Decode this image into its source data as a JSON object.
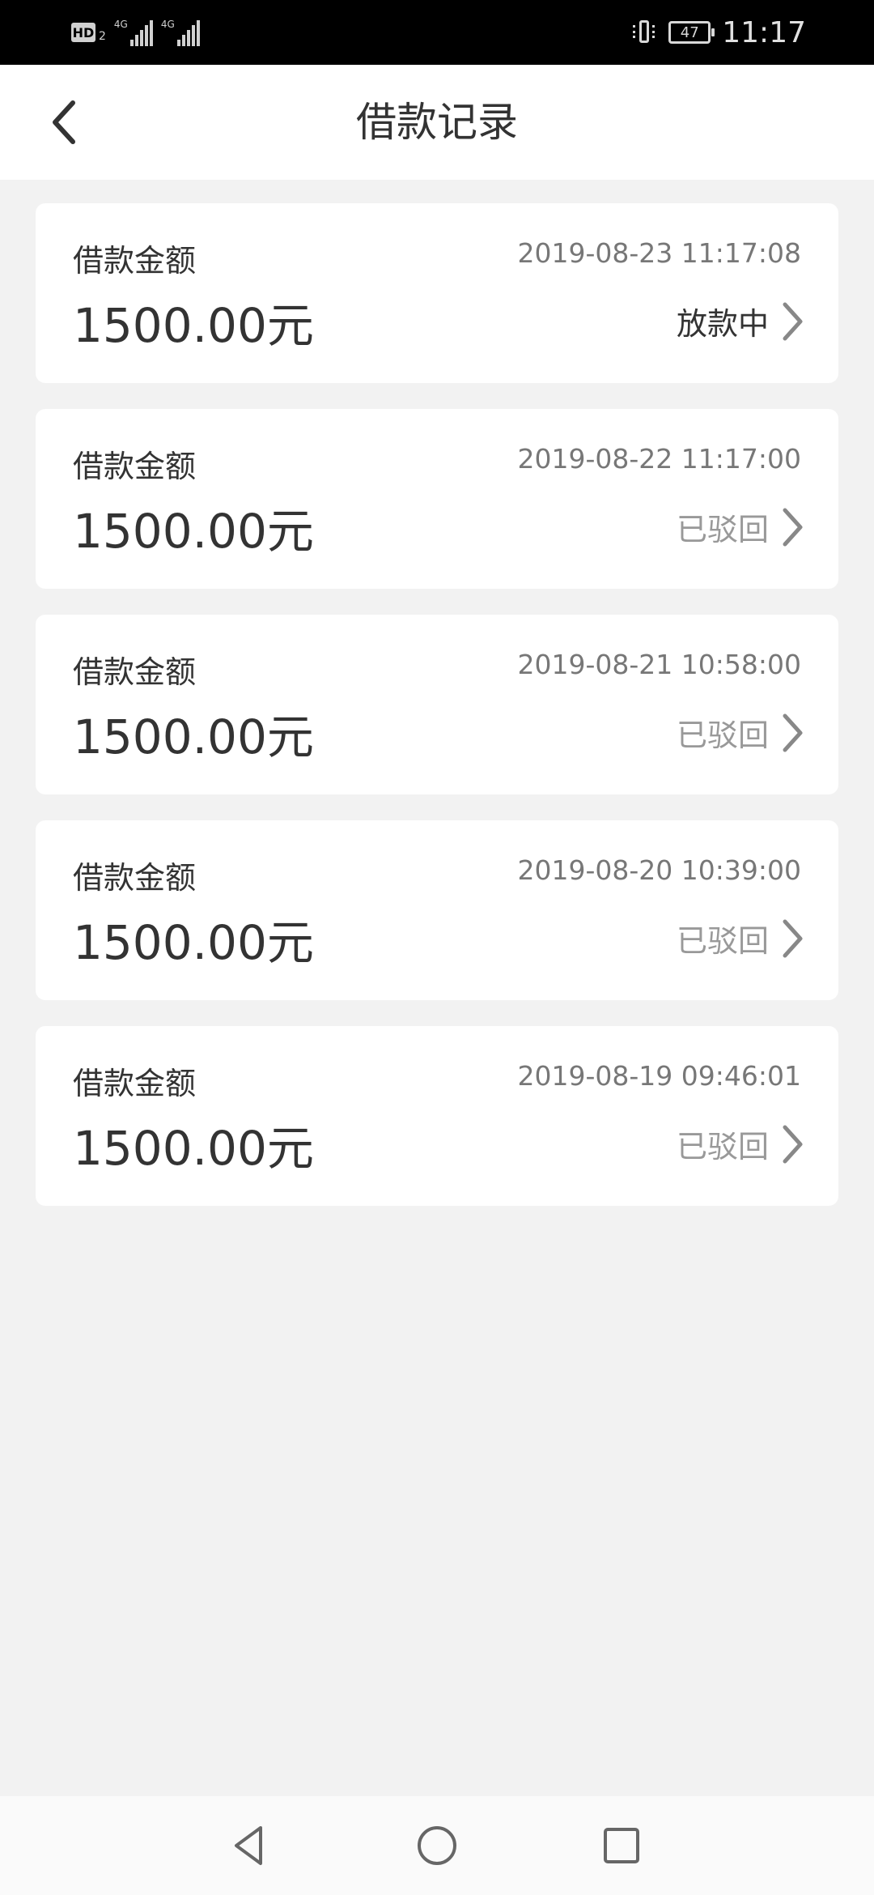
{
  "status_bar": {
    "hd": "HD",
    "hd_sub": "2",
    "network_1": "4G",
    "network_2": "4G",
    "battery": "47",
    "time": "11:17"
  },
  "header": {
    "title": "借款记录"
  },
  "records": [
    {
      "label": "借款金额",
      "amount": "1500.00元",
      "time": "2019-08-23 11:17:08",
      "status": "放款中"
    },
    {
      "label": "借款金额",
      "amount": "1500.00元",
      "time": "2019-08-22 11:17:00",
      "status": "已驳回"
    },
    {
      "label": "借款金额",
      "amount": "1500.00元",
      "time": "2019-08-21 10:58:00",
      "status": "已驳回"
    },
    {
      "label": "借款金额",
      "amount": "1500.00元",
      "time": "2019-08-20 10:39:00",
      "status": "已驳回"
    },
    {
      "label": "借款金额",
      "amount": "1500.00元",
      "time": "2019-08-19 09:46:01",
      "status": "已驳回"
    }
  ],
  "colors": {
    "background": "#f2f2f2",
    "card": "#ffffff",
    "text_primary": "#333333",
    "text_secondary": "#777777",
    "status_rejected": "#999999",
    "chevron": "#888888"
  },
  "icons": {
    "back": "chevron-left-icon",
    "record_arrow": "chevron-right-icon",
    "nav_back": "triangle-back-icon",
    "nav_home": "circle-home-icon",
    "nav_recents": "square-recents-icon"
  }
}
